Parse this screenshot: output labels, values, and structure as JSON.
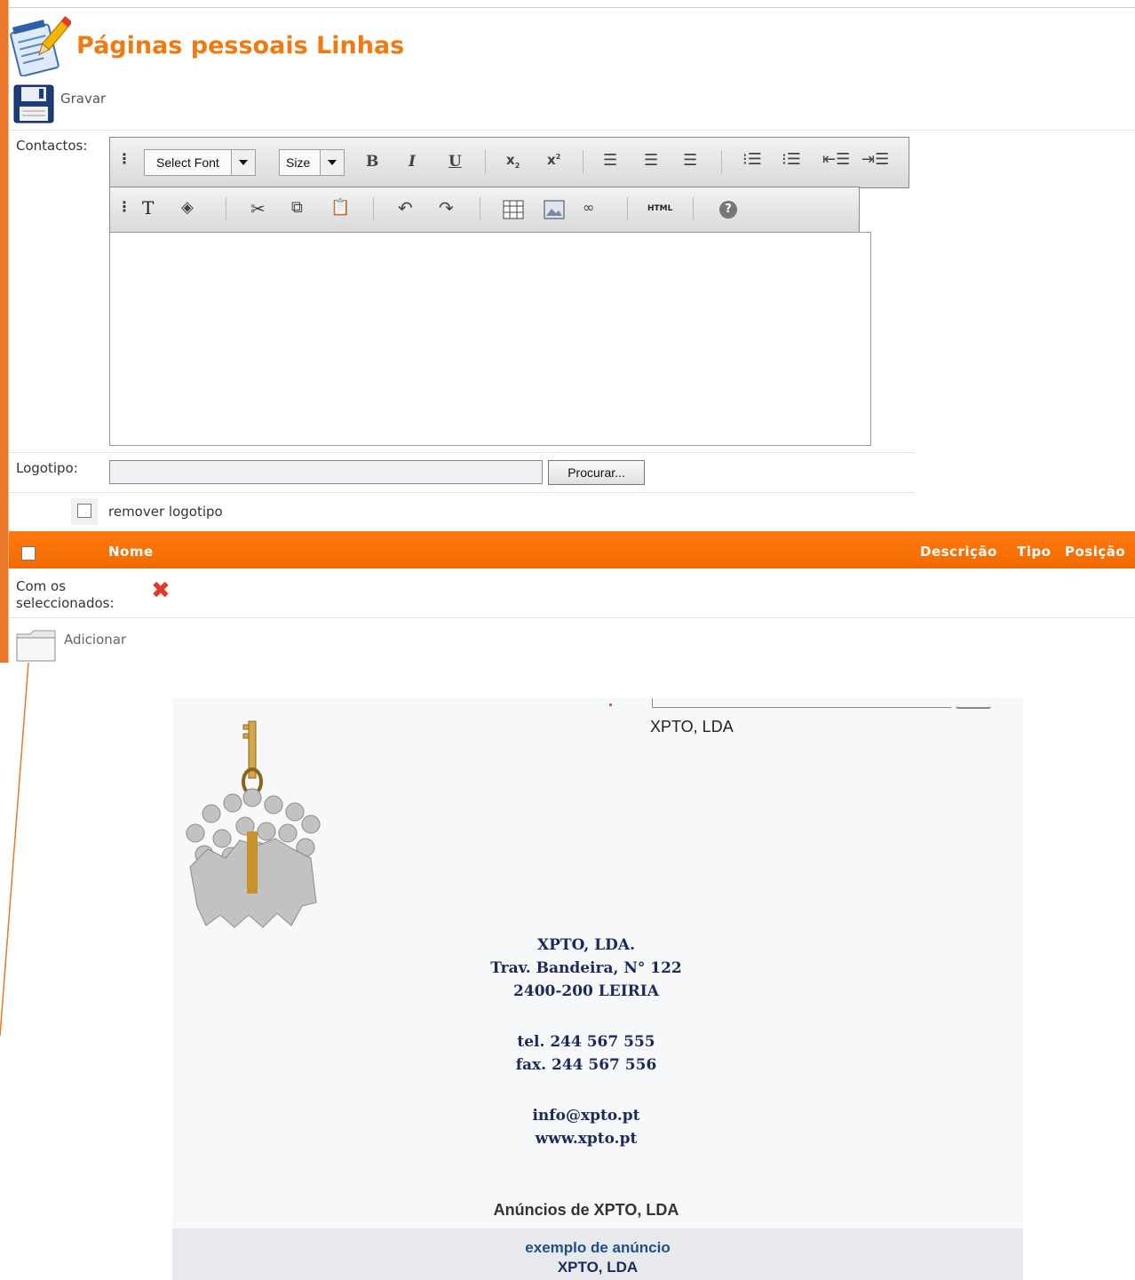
{
  "page": {
    "title": "Páginas pessoais Linhas",
    "save_label": "Gravar"
  },
  "form": {
    "contactos_label": "Contactos:",
    "logotipo_label": "Logotipo:",
    "browse_label": "Procurar...",
    "remove_logo_label": "remover logotipo"
  },
  "editor": {
    "font_select": "Select Font",
    "size_select": "Size",
    "bold": "B",
    "italic": "I",
    "underline": "U",
    "html_label": "HTML"
  },
  "table": {
    "col_nome": "Nome",
    "col_descricao": "Descrição",
    "col_tipo": "Tipo",
    "col_posicao": "Posição",
    "selected_label_1": "Com os",
    "selected_label_2": "seleccionados:",
    "add_label": "Adicionar"
  },
  "preview": {
    "company_name": "XPTO, LDA",
    "address": [
      "XPTO, LDA.",
      "Trav. Bandeira, N° 122",
      "2400-200 LEIRIA"
    ],
    "phones": [
      "tel. 244 567 555",
      "fax. 244 567 556"
    ],
    "web": [
      "info@xpto.pt",
      "www.xpto.pt"
    ],
    "ads_title": "Anúncios de XPTO, LDA",
    "ad_title": "exemplo de anúncio",
    "ad_company": "XPTO, LDA"
  },
  "colors": {
    "accent": "#f07a10",
    "header_bar": "#ff7a10"
  }
}
